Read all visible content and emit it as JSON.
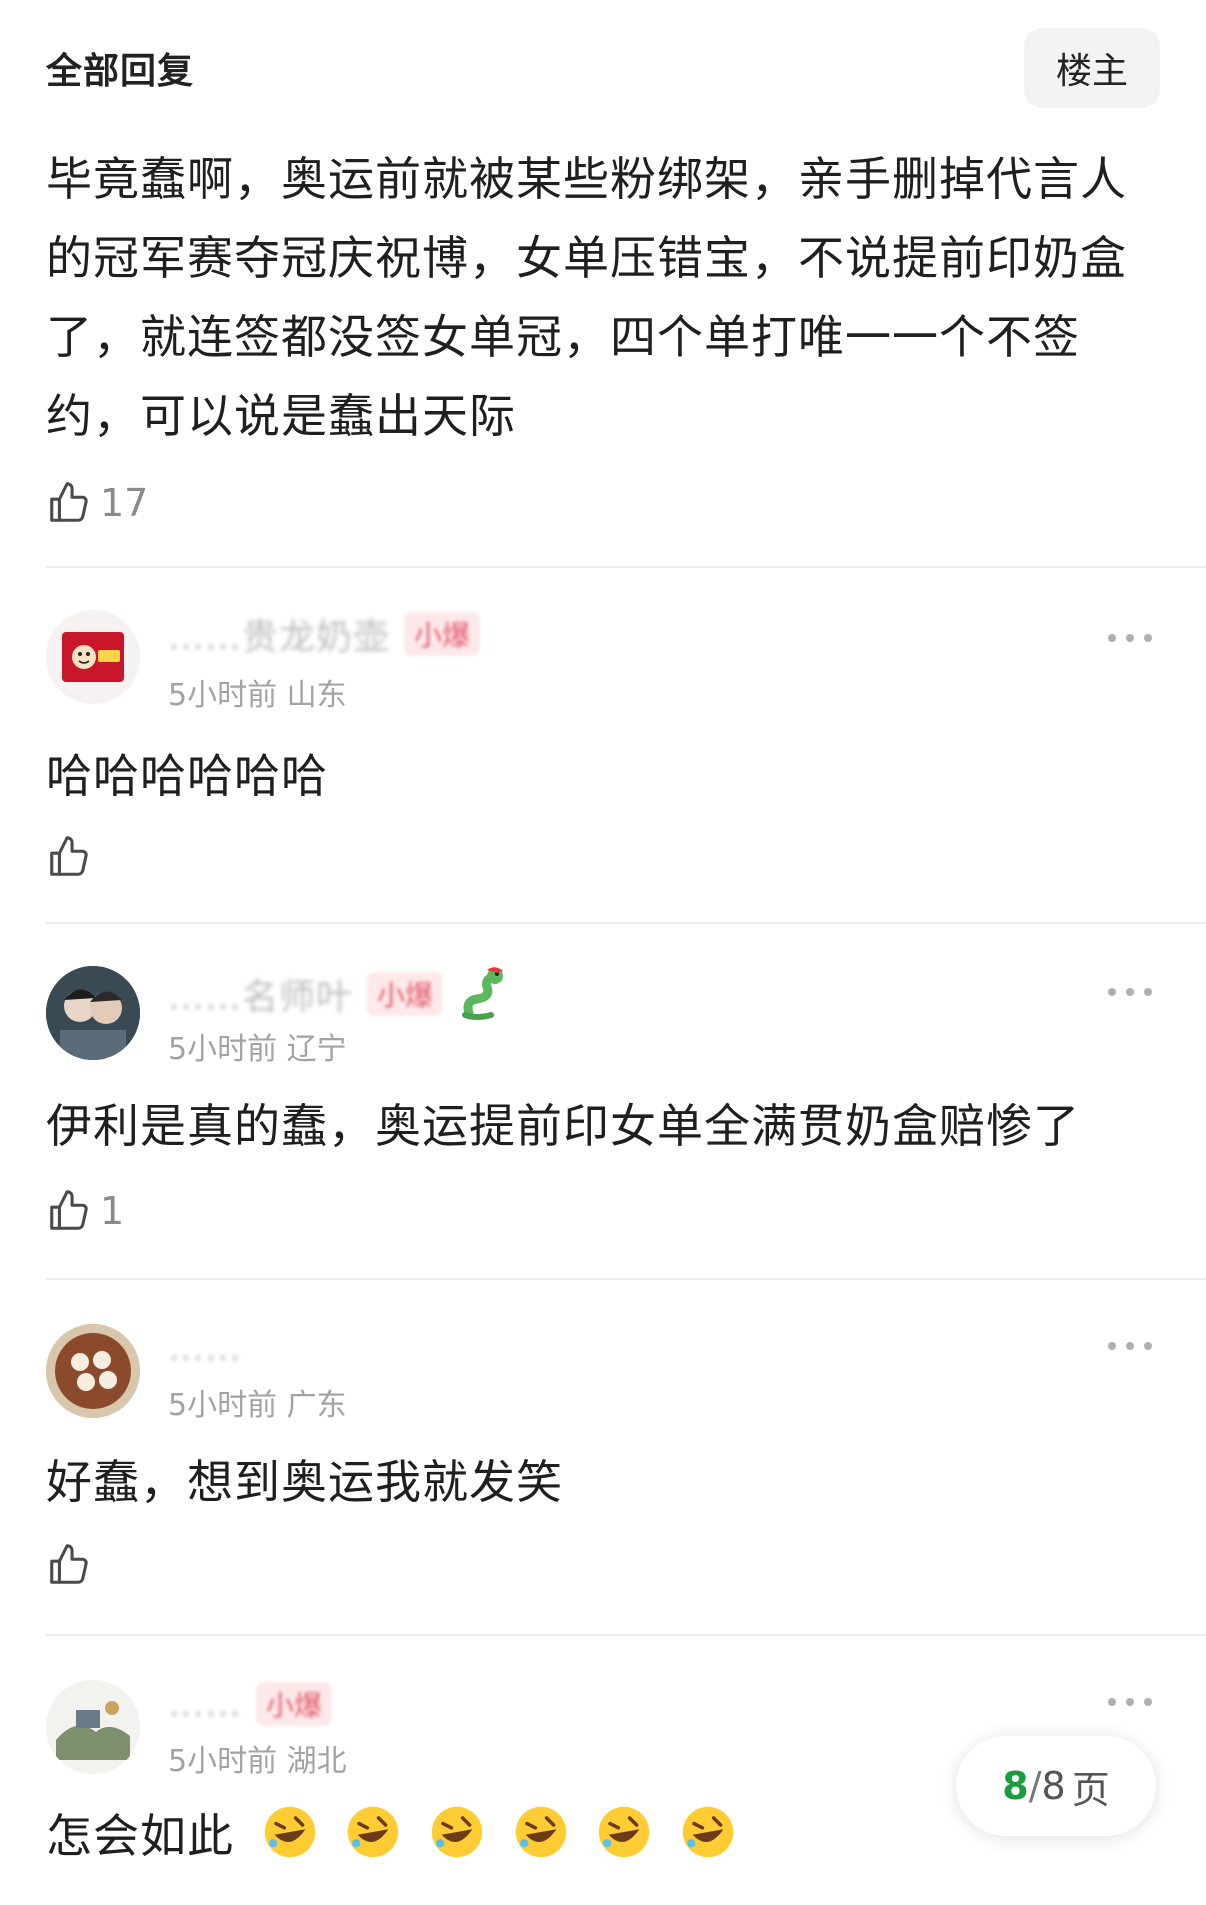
{
  "header": {
    "title": "全部回复",
    "louzhu_label": "楼主"
  },
  "op": {
    "text": "毕竟蠢啊，奥运前就被某些粉绑架，亲手删掉代言人的冠军赛夺冠庆祝博，女单压错宝，不说提前印奶盒了，就连签都没签女单冠，四个单打唯一一个不签约，可以说是蠢出天际",
    "likes": "17"
  },
  "replies": [
    {
      "username": "……贵龙奶壶",
      "badge": "小爆",
      "meta": "5小时前 山东",
      "text": "哈哈哈哈哈哈",
      "likes": "",
      "avatar_icon": "snack-package-avatar"
    },
    {
      "username": "……名师叶",
      "badge": "小爆",
      "meta": "5小时前 辽宁",
      "text": "伊利是真的蠢，奥运提前印女单全满贯奶盒赔惨了",
      "likes": "1",
      "avatar_icon": "two-people-photo-avatar"
    },
    {
      "username": "……",
      "badge": "",
      "meta": "5小时前 广东",
      "text": "好蠢，想到奥运我就发笑",
      "likes": "",
      "avatar_icon": "dumplings-bowl-avatar"
    },
    {
      "username": "……",
      "badge": "小爆",
      "meta": "5小时前 湖北",
      "text": "怎会如此",
      "likes": "",
      "avatar_icon": "painting-avatar"
    }
  ],
  "pagination": {
    "current": "8",
    "sep": "/",
    "total": "8",
    "unit": "页"
  },
  "colors": {
    "accent_green": "#1a9d3c",
    "badge_pink": "#e35a6b",
    "text_primary": "#1f1f1f",
    "text_secondary": "#a3a3a3"
  }
}
